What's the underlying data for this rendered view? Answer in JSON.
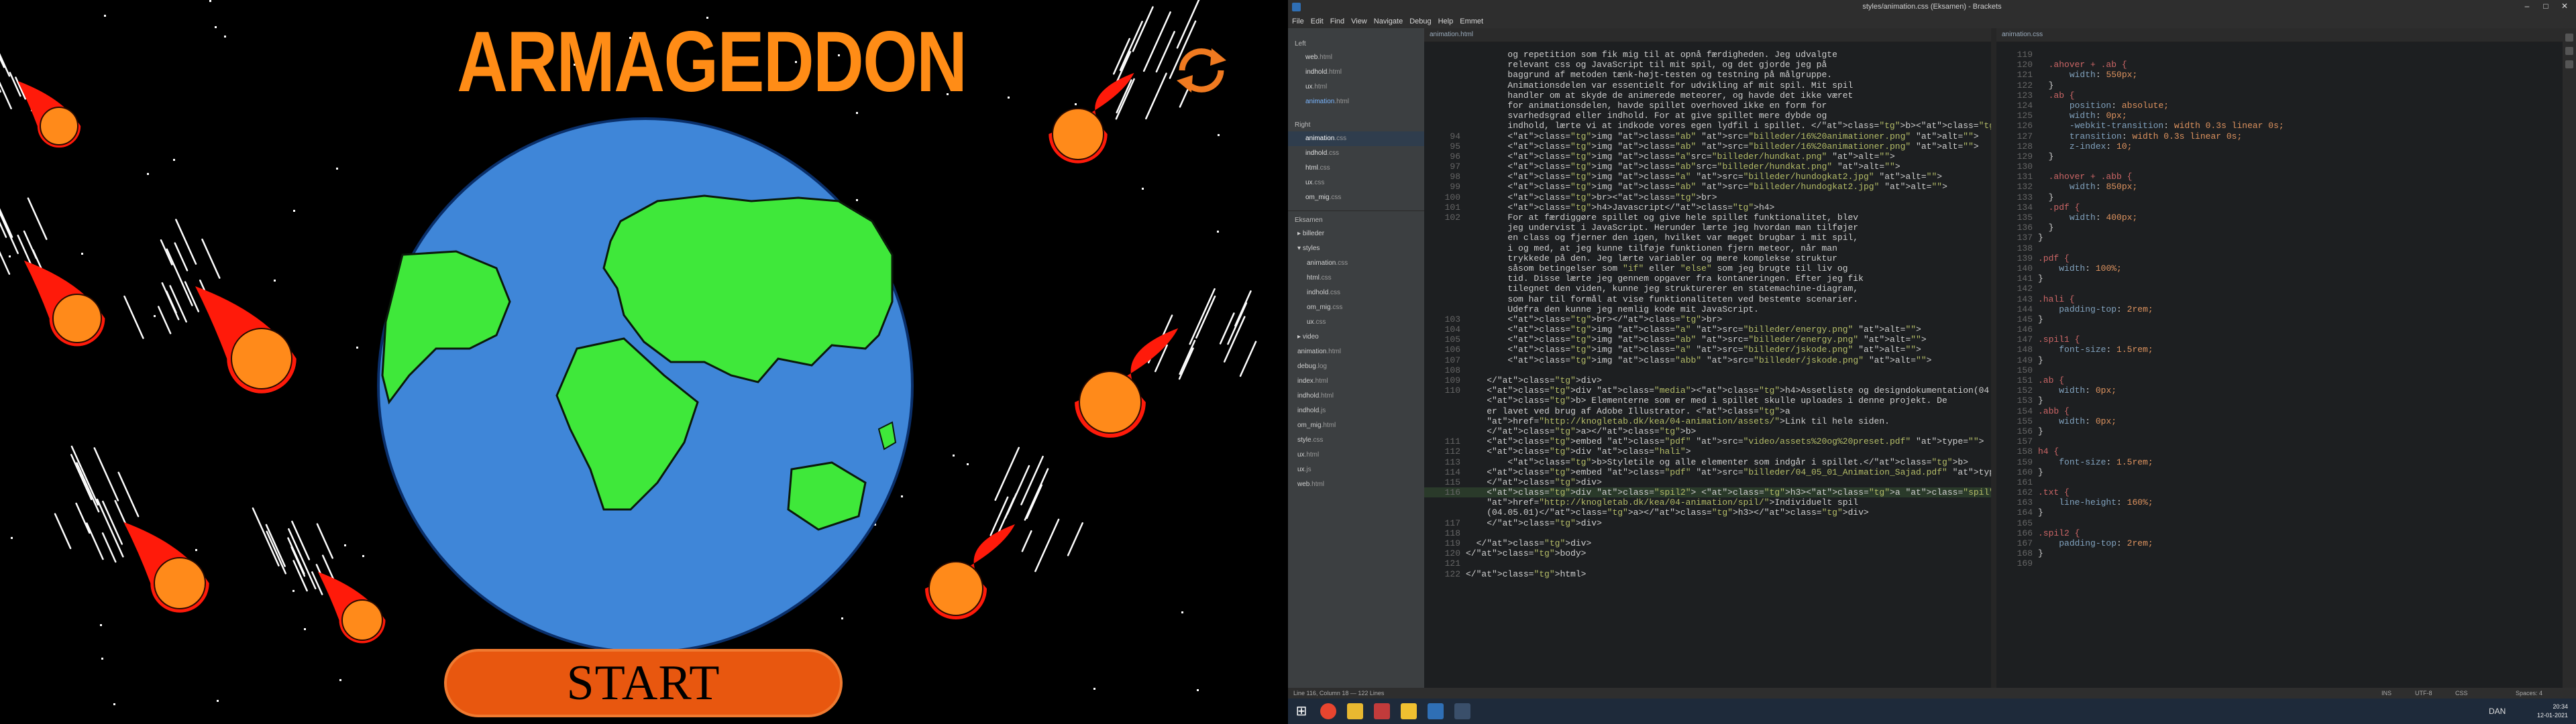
{
  "game": {
    "title": "ARMAGEDDON",
    "start_label": "START"
  },
  "window": {
    "title": "styles/animation.css (Eksamen) - Brackets",
    "controls": [
      "–",
      "□",
      "✕"
    ]
  },
  "menu": [
    "File",
    "Edit",
    "Find",
    "View",
    "Navigate",
    "Debug",
    "Help",
    "Emmet"
  ],
  "sidebar": {
    "left_label": "Left",
    "left_files": [
      {
        "name": "web",
        "ext": ".html"
      },
      {
        "name": "indhold",
        "ext": ".html"
      },
      {
        "name": "ux",
        "ext": ".html"
      },
      {
        "name": "animation",
        "ext": ".html"
      }
    ],
    "right_label": "Right",
    "right_files": [
      {
        "name": "animation",
        "ext": ".css"
      },
      {
        "name": "indhold",
        "ext": ".css"
      },
      {
        "name": "html",
        "ext": ".css"
      },
      {
        "name": "ux",
        "ext": ".css"
      },
      {
        "name": "om_mig",
        "ext": ".css"
      }
    ],
    "project_label": "Eksamen",
    "tree": [
      {
        "name": "billeder",
        "ext": "",
        "folder": true,
        "indent": 0
      },
      {
        "name": "styles",
        "ext": "",
        "folder": true,
        "open": true,
        "indent": 0
      },
      {
        "name": "animation",
        "ext": ".css",
        "indent": 1
      },
      {
        "name": "html",
        "ext": ".css",
        "indent": 1
      },
      {
        "name": "indhold",
        "ext": ".css",
        "indent": 1
      },
      {
        "name": "om_mig",
        "ext": ".css",
        "indent": 1
      },
      {
        "name": "ux",
        "ext": ".css",
        "indent": 1
      },
      {
        "name": "video",
        "ext": "",
        "folder": true,
        "indent": 0
      },
      {
        "name": "animation",
        "ext": ".html",
        "indent": 0
      },
      {
        "name": "debug",
        "ext": ".log",
        "indent": 0
      },
      {
        "name": "index",
        "ext": ".html",
        "indent": 0
      },
      {
        "name": "indhold",
        "ext": ".html",
        "indent": 0
      },
      {
        "name": "indhold",
        "ext": ".js",
        "indent": 0
      },
      {
        "name": "om_mig",
        "ext": ".html",
        "indent": 0
      },
      {
        "name": "style",
        "ext": ".css",
        "indent": 0
      },
      {
        "name": "ux",
        "ext": ".html",
        "indent": 0
      },
      {
        "name": "ux",
        "ext": ".js",
        "indent": 0
      },
      {
        "name": "web",
        "ext": ".html",
        "indent": 0
      }
    ]
  },
  "html_editor": {
    "tab": "animation.html",
    "lines": [
      {
        "n": "",
        "t": "        og repetition som fik mig til at opnå færdigheden. Jeg udvalgte"
      },
      {
        "n": "",
        "t": "        relevant css og JavaScript til mit spil, og det gjorde jeg på"
      },
      {
        "n": "",
        "t": "        baggrund af metoden tænk-højt-testen og testning på målgruppe."
      },
      {
        "n": "",
        "t": "        Animationsdelen var essentielt for udvikling af mit spil. Mit spil"
      },
      {
        "n": "",
        "t": "        handler om at skyde de animerede meteorer, og havde det ikke været"
      },
      {
        "n": "",
        "t": "        for animationsdelen, havde spillet overhoved ikke en form for"
      },
      {
        "n": "",
        "t": "        svarhedsgrad eller indhold. For at give spillet mere dybde og"
      },
      {
        "n": "",
        "t": "        indhold, lærte vi at indkode vores egen lydfil i spillet. </b><br>"
      },
      {
        "n": "94",
        "t": "        <img class=\"ab\" src=\"billeder/16%20animationer.png\" alt=\"\">"
      },
      {
        "n": "95",
        "t": "        <img class=\"ab\" src=\"billeder/16%20animationer.png\" alt=\"\">"
      },
      {
        "n": "96",
        "t": "        <img class=\"a\"src=\"billeder/hundkat.png\" alt=\"\">"
      },
      {
        "n": "97",
        "t": "        <img class=\"ab\"src=\"billeder/hundkat.png\" alt=\"\">"
      },
      {
        "n": "98",
        "t": "        <img class=\"a\" src=\"billeder/hundogkat2.jpg\" alt=\"\">"
      },
      {
        "n": "99",
        "t": "        <img class=\"ab\" src=\"billeder/hundogkat2.jpg\" alt=\"\">"
      },
      {
        "n": "100",
        "t": "        <br><br>"
      },
      {
        "n": "101",
        "t": "        <h4>Javascript</h4>"
      },
      {
        "n": "102",
        "t": "        For at færdiggøre spillet og give hele spillet funktionalitet, blev"
      },
      {
        "n": "",
        "t": "        jeg undervist i JavaScript. Herunder lærte jeg hvordan man tilføjer"
      },
      {
        "n": "",
        "t": "        en class og fjerner den igen, hvilket var meget brugbar i mit spil,"
      },
      {
        "n": "",
        "t": "        i og med, at jeg kunne tilføje funktionen fjern meteor, når man"
      },
      {
        "n": "",
        "t": "        trykkede på den. Jeg lærte variabler og mere komplekse struktur"
      },
      {
        "n": "",
        "t": "        såsom betingelser som \"if\" eller \"else\" som jeg brugte til liv og"
      },
      {
        "n": "",
        "t": "        tid. Disse lærte jeg gennem opgaver fra kontaneringen. Efter jeg fik"
      },
      {
        "n": "",
        "t": "        tilegnet den viden, kunne jeg strukturerer en statemachine-diagram,"
      },
      {
        "n": "",
        "t": "        som har til formål at vise funktionaliteten ved bestemte scenarier."
      },
      {
        "n": "",
        "t": "        Udefra den kunne jeg nemlig kode mit JavaScript."
      },
      {
        "n": "103",
        "t": "        <br></br>"
      },
      {
        "n": "104",
        "t": "        <img class=\"a\" src=\"billeder/energy.png\" alt=\"\">"
      },
      {
        "n": "105",
        "t": "        <img class=\"ab\" src=\"billeder/energy.png\" alt=\"\">"
      },
      {
        "n": "106",
        "t": "        <img class=\"a\" src=\"billeder/jskode.png\" alt=\"\">"
      },
      {
        "n": "107",
        "t": "        <img class=\"abb\" src=\"billeder/jskode.png\" alt=\"\">"
      },
      {
        "n": "108",
        "t": ""
      },
      {
        "n": "109",
        "t": "    </div>"
      },
      {
        "n": "110",
        "t": "    <div class=\"media\"><h4>Assetliste og designdokumentation(04.01.05).</h4>"
      },
      {
        "n": "",
        "t": "    <b> Elementerne som er med i spillet skulle uploades i denne projekt. De"
      },
      {
        "n": "",
        "t": "    er lavet ved brug af Adobe Illustrator. <a"
      },
      {
        "n": "",
        "t": "    href=\"http://knogletab.dk/kea/04-animation/assets/\">Link til hele siden."
      },
      {
        "n": "",
        "t": "    </a></b>"
      },
      {
        "n": "111",
        "t": "    <embed class=\"pdf\" src=\"video/assets%20og%20preset.pdf\" type=\"\">"
      },
      {
        "n": "112",
        "t": "    <div class=\"hali\">"
      },
      {
        "n": "113",
        "t": "        <b>Styletile og alle elementer som indgår i spillet.</b>"
      },
      {
        "n": "114",
        "t": "    <embed class=\"pdf\" src=\"billeder/04_05_01_Animation_Sajad.pdf\" type=\"\">"
      },
      {
        "n": "115",
        "t": "    </div>"
      },
      {
        "n": "116",
        "t": "    <div class=\"spil2\"> <h3><a class=\"spil\"",
        "cur": true
      },
      {
        "n": "",
        "t": "    href=\"http://knogletab.dk/kea/04-animation/spil/\">Individuelt spil"
      },
      {
        "n": "",
        "t": "    (04.05.01)</a></h3></div>"
      },
      {
        "n": "117",
        "t": "    </div>"
      },
      {
        "n": "118",
        "t": ""
      },
      {
        "n": "119",
        "t": "  </div>"
      },
      {
        "n": "120",
        "t": "</body>"
      },
      {
        "n": "121",
        "t": ""
      },
      {
        "n": "122",
        "t": "</html>"
      }
    ]
  },
  "css_editor": {
    "tab": "animation.css",
    "lines": [
      {
        "n": "119",
        "t": ""
      },
      {
        "n": "120",
        "t": "  .ahover + .ab {"
      },
      {
        "n": "121",
        "t": "      width: 550px;"
      },
      {
        "n": "122",
        "t": "  }"
      },
      {
        "n": "123",
        "t": "  .ab {"
      },
      {
        "n": "124",
        "t": "      position: absolute;"
      },
      {
        "n": "125",
        "t": "      width: 0px;"
      },
      {
        "n": "126",
        "t": "      -webkit-transition: width 0.3s linear 0s;"
      },
      {
        "n": "127",
        "t": "      transition: width 0.3s linear 0s;"
      },
      {
        "n": "128",
        "t": "      z-index: 10;"
      },
      {
        "n": "129",
        "t": "  }"
      },
      {
        "n": "130",
        "t": ""
      },
      {
        "n": "131",
        "t": "  .ahover + .abb {"
      },
      {
        "n": "132",
        "t": "      width: 850px;"
      },
      {
        "n": "133",
        "t": "  }"
      },
      {
        "n": "134",
        "t": "  .pdf {"
      },
      {
        "n": "135",
        "t": "      width: 400px;"
      },
      {
        "n": "136",
        "t": "  }"
      },
      {
        "n": "137",
        "t": "}"
      },
      {
        "n": "138",
        "t": ""
      },
      {
        "n": "139",
        "t": ".pdf {"
      },
      {
        "n": "140",
        "t": "    width: 100%;"
      },
      {
        "n": "141",
        "t": "}"
      },
      {
        "n": "142",
        "t": ""
      },
      {
        "n": "143",
        "t": ".hali {"
      },
      {
        "n": "144",
        "t": "    padding-top: 2rem;"
      },
      {
        "n": "145",
        "t": "}"
      },
      {
        "n": "146",
        "t": ""
      },
      {
        "n": "147",
        "t": ".spil1 {"
      },
      {
        "n": "148",
        "t": "    font-size: 1.5rem;"
      },
      {
        "n": "149",
        "t": "}"
      },
      {
        "n": "150",
        "t": ""
      },
      {
        "n": "151",
        "t": ".ab {"
      },
      {
        "n": "152",
        "t": "    width: 0px;"
      },
      {
        "n": "153",
        "t": "}"
      },
      {
        "n": "154",
        "t": ".abb {"
      },
      {
        "n": "155",
        "t": "    width: 0px;"
      },
      {
        "n": "156",
        "t": "}"
      },
      {
        "n": "157",
        "t": ""
      },
      {
        "n": "158",
        "t": "h4 {"
      },
      {
        "n": "159",
        "t": "    font-size: 1.5rem;"
      },
      {
        "n": "160",
        "t": "}"
      },
      {
        "n": "161",
        "t": ""
      },
      {
        "n": "162",
        "t": ".txt {"
      },
      {
        "n": "163",
        "t": "    line-height: 160%;"
      },
      {
        "n": "164",
        "t": "}"
      },
      {
        "n": "165",
        "t": ""
      },
      {
        "n": "166",
        "t": ".spil2 {"
      },
      {
        "n": "167",
        "t": "    padding-top: 2rem;"
      },
      {
        "n": "168",
        "t": "}"
      },
      {
        "n": "169",
        "t": ""
      }
    ]
  },
  "status": {
    "position": "Line 116, Column 18 — 122 Lines",
    "ins": "INS",
    "encoding": "UTF-8",
    "language": "CSS",
    "spaces": "Spaces: 4"
  },
  "taskbar": {
    "lang": "DAN",
    "time": "20:34",
    "date": "12-01-2021"
  },
  "colors": {
    "title_orange": "#ff8c16",
    "start_button": "#e8570f",
    "earth_ocean": "#3f86d8",
    "earth_land": "#3fe83a",
    "meteor_core": "#ff8a1a",
    "meteor_tail": "#ff1a0a"
  }
}
